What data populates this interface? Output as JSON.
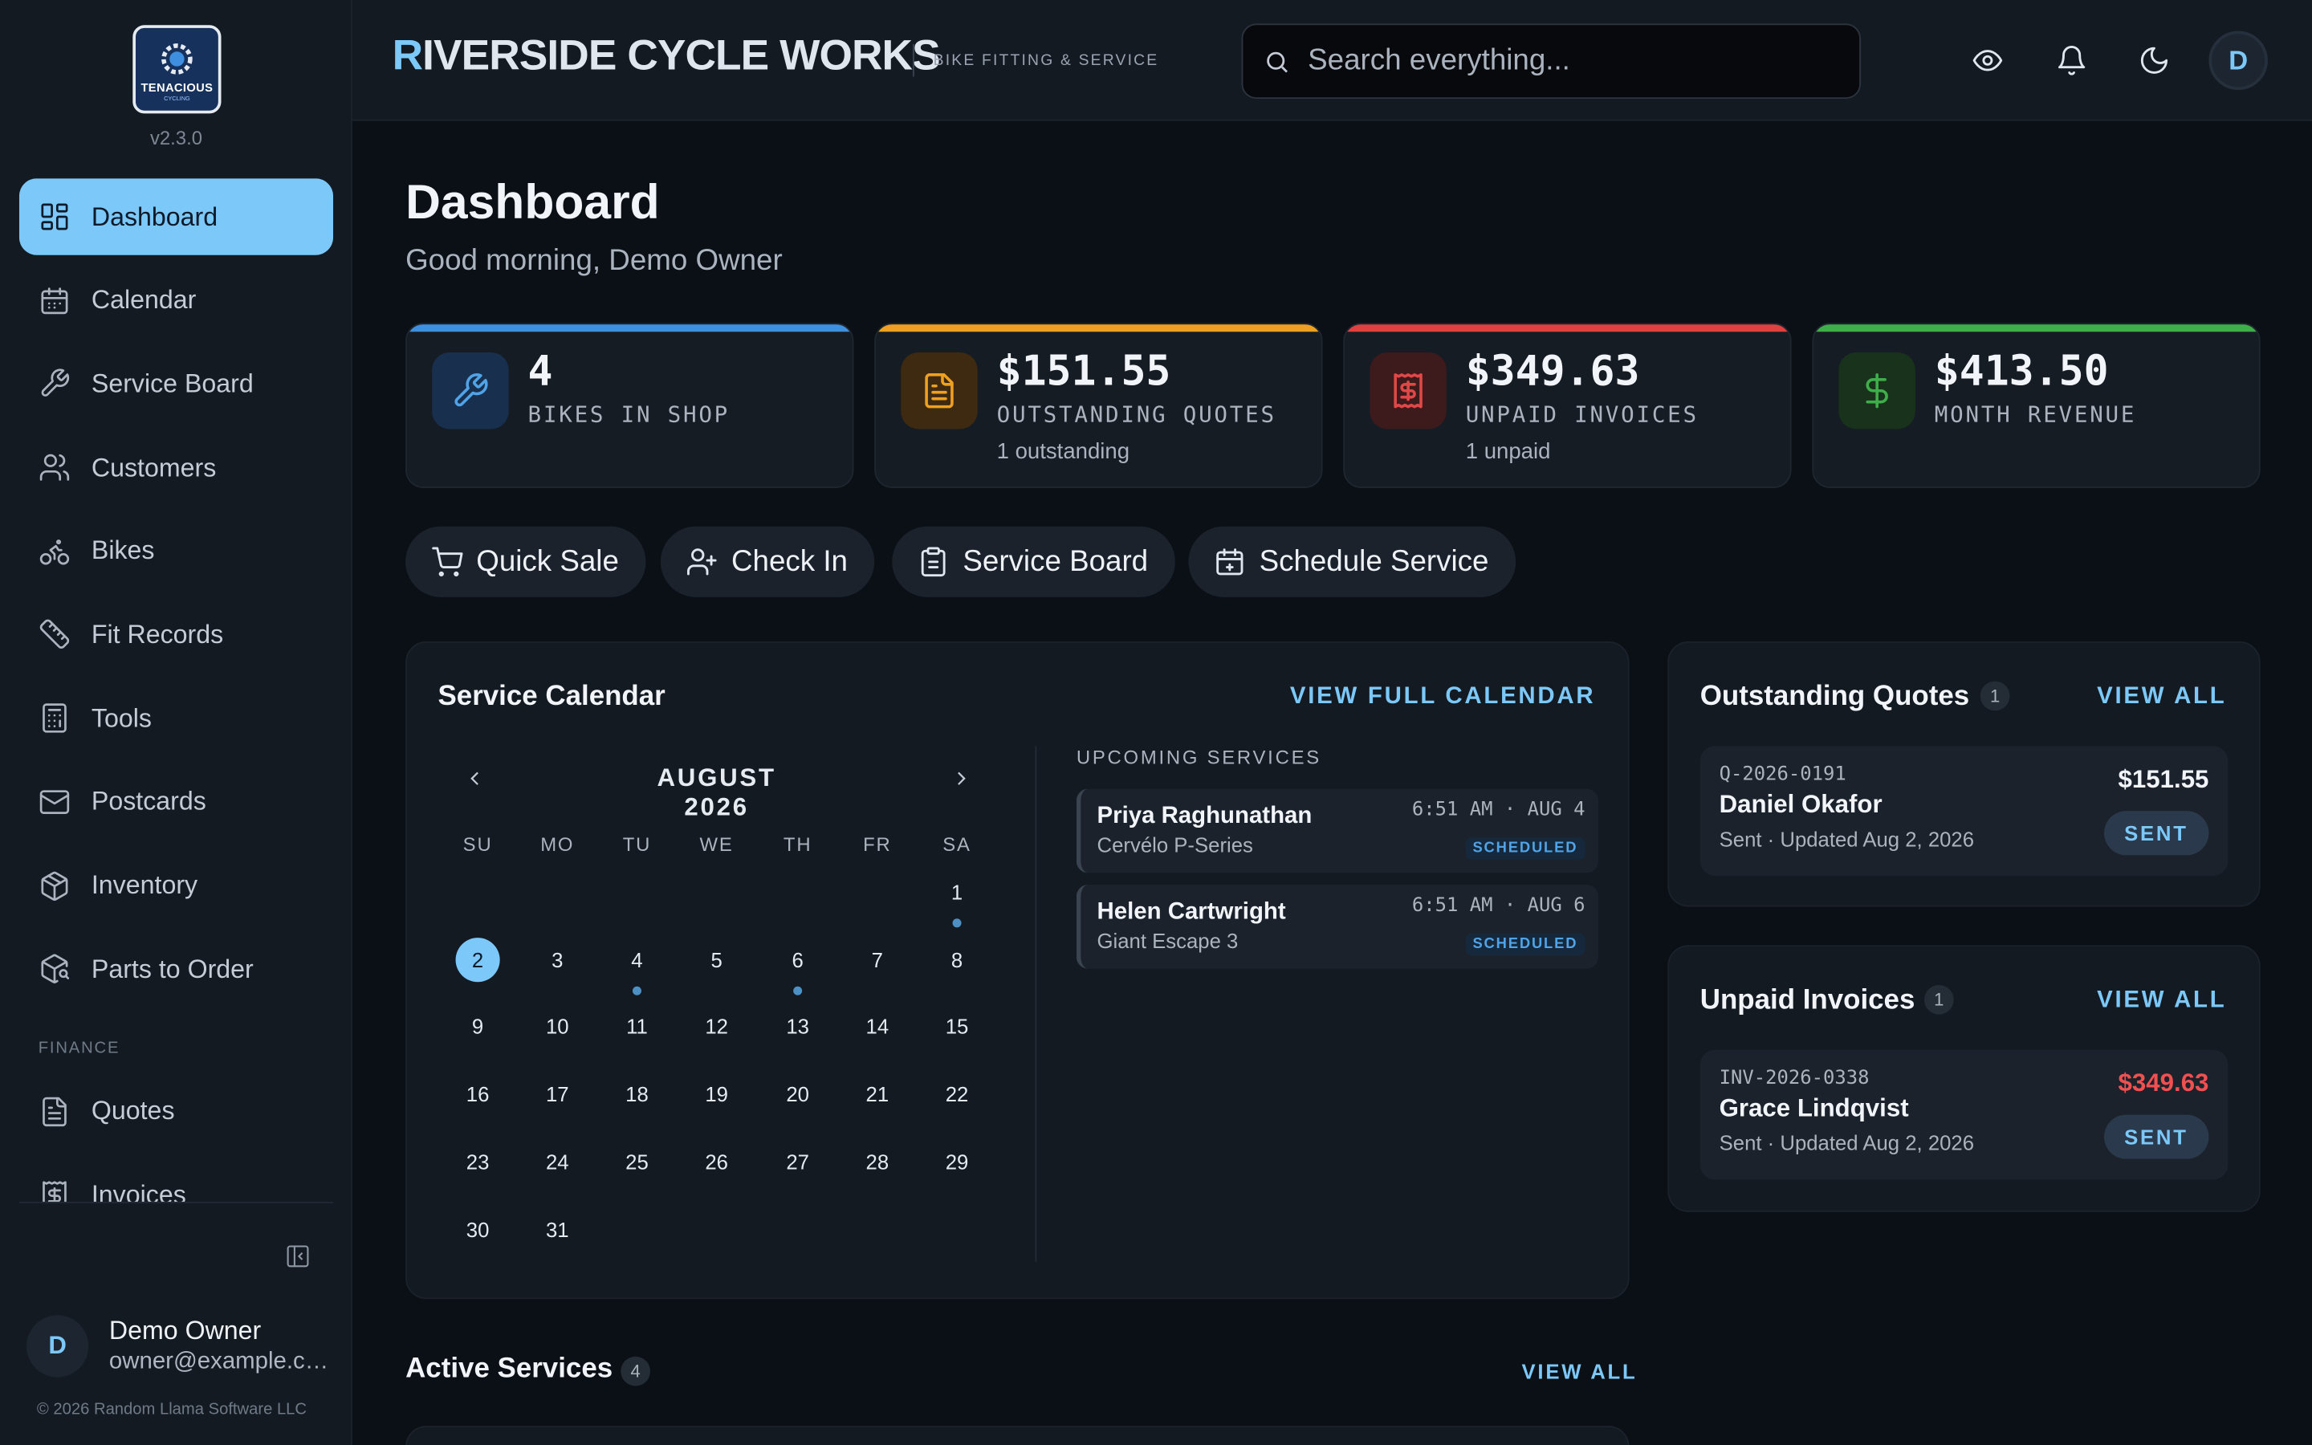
{
  "app": {
    "logo_text": "TENACIOUS",
    "logo_sub": "CYCLING",
    "version": "v2.3.0",
    "brand_first": "R",
    "brand_rest": "IVERSIDE CYCLE WORKS",
    "brand_tagline": "BIKE FITTING & SERVICE",
    "accent": "#7cc8f8"
  },
  "search": {
    "placeholder": "Search everything..."
  },
  "header": {
    "avatar_initial": "D"
  },
  "sidebar": {
    "items": [
      {
        "label": "Dashboard",
        "icon": "dashboard-icon",
        "active": true
      },
      {
        "label": "Calendar",
        "icon": "calendar-icon"
      },
      {
        "label": "Service Board",
        "icon": "wrench-icon"
      },
      {
        "label": "Customers",
        "icon": "users-icon"
      },
      {
        "label": "Bikes",
        "icon": "bike-icon"
      },
      {
        "label": "Fit Records",
        "icon": "ruler-icon"
      },
      {
        "label": "Tools",
        "icon": "calculator-icon"
      },
      {
        "label": "Postcards",
        "icon": "mail-icon"
      },
      {
        "label": "Inventory",
        "icon": "package-icon"
      },
      {
        "label": "Parts to Order",
        "icon": "package-search-icon"
      }
    ],
    "finance_label": "FINANCE",
    "finance_items": [
      {
        "label": "Quotes",
        "icon": "file-text-icon"
      },
      {
        "label": "Invoices",
        "icon": "receipt-icon"
      }
    ],
    "user": {
      "initial": "D",
      "name": "Demo Owner",
      "email": "owner@example.com"
    },
    "copyright": "© 2026 Random Llama Software LLC"
  },
  "page": {
    "title": "Dashboard",
    "greeting": "Good morning, Demo Owner"
  },
  "stats": [
    {
      "value": "4",
      "label": "BIKES IN SHOP",
      "sub": "",
      "color": "#3f8fe0",
      "icon": "wrench-icon"
    },
    {
      "value": "$151.55",
      "label": "OUTSTANDING QUOTES",
      "sub": "1 outstanding",
      "color": "#f0a020",
      "icon": "file-text-icon"
    },
    {
      "value": "$349.63",
      "label": "UNPAID INVOICES",
      "sub": "1 unpaid",
      "color": "#e04040",
      "icon": "receipt-icon"
    },
    {
      "value": "$413.50",
      "label": "MONTH REVENUE",
      "sub": "",
      "color": "#3fae4a",
      "icon": "dollar-icon"
    }
  ],
  "quick_actions": [
    {
      "label": "Quick Sale",
      "icon": "cart-icon"
    },
    {
      "label": "Check In",
      "icon": "user-plus-icon"
    },
    {
      "label": "Service Board",
      "icon": "clipboard-icon"
    },
    {
      "label": "Schedule Service",
      "icon": "calendar-plus-icon"
    }
  ],
  "calendar": {
    "title": "Service Calendar",
    "link": "VIEW FULL CALENDAR",
    "month": "AUGUST 2026",
    "weekdays": [
      "SU",
      "MO",
      "TU",
      "WE",
      "TH",
      "FR",
      "SA"
    ],
    "first_weekday": 6,
    "days_in_month": 31,
    "today": 2,
    "event_days": [
      1,
      4,
      6
    ],
    "upcoming_title": "UPCOMING SERVICES",
    "upcoming": [
      {
        "name": "Priya Raghunathan",
        "bike": "Cervélo P-Series",
        "time": "6:51 AM · AUG 4",
        "status": "SCHEDULED"
      },
      {
        "name": "Helen Cartwright",
        "bike": "Giant Escape 3",
        "time": "6:51 AM · AUG 6",
        "status": "SCHEDULED"
      }
    ]
  },
  "quotes": {
    "title": "Outstanding Quotes",
    "count": "1",
    "link": "VIEW ALL",
    "items": [
      {
        "number": "Q-2026-0191",
        "name": "Daniel Okafor",
        "meta": "Sent · Updated Aug 2, 2026",
        "amount": "$151.55",
        "status": "SENT"
      }
    ]
  },
  "invoices": {
    "title": "Unpaid Invoices",
    "count": "1",
    "link": "VIEW ALL",
    "items": [
      {
        "number": "INV-2026-0338",
        "name": "Grace Lindqvist",
        "meta": "Sent · Updated Aug 2, 2026",
        "amount": "$349.63",
        "status": "SENT"
      }
    ]
  },
  "active_services": {
    "title": "Active Services",
    "count": "4",
    "link": "VIEW ALL"
  }
}
